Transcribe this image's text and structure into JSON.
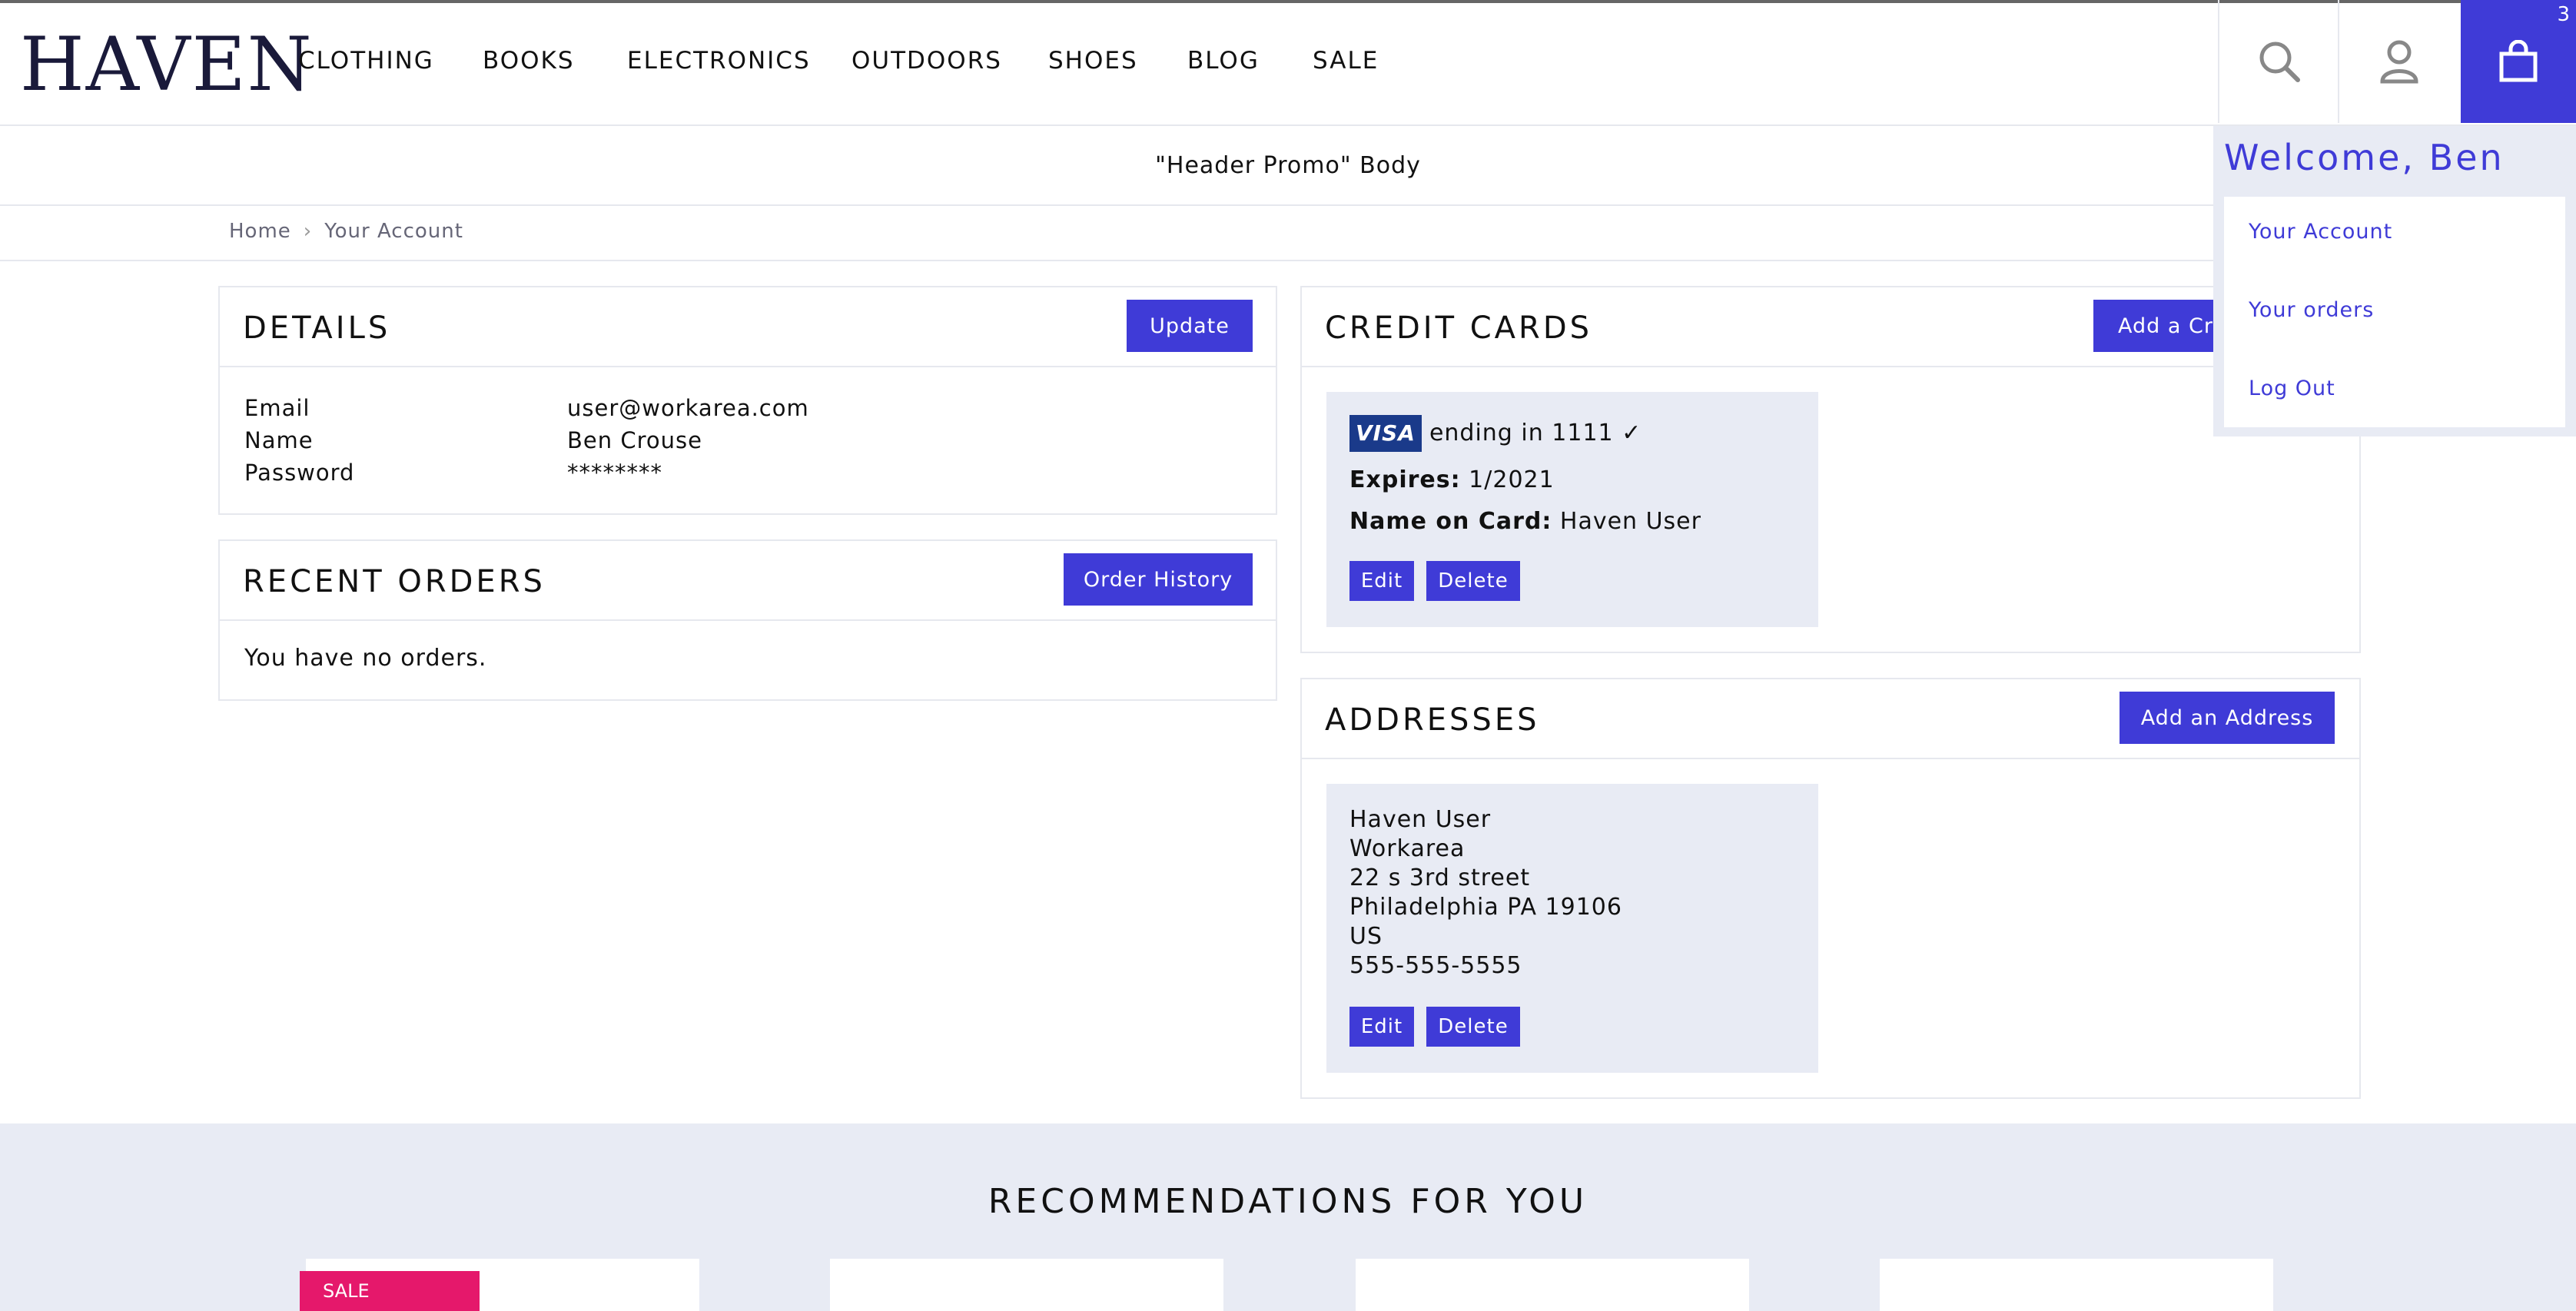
{
  "brand": {
    "logo_text": "HAVEN"
  },
  "nav": {
    "items": [
      "CLOTHING",
      "BOOKS",
      "ELECTRONICS",
      "OUTDOORS",
      "SHOES",
      "BLOG",
      "SALE"
    ]
  },
  "header": {
    "cart_count": "3"
  },
  "promo": {
    "text": "\"Header Promo\" Body"
  },
  "breadcrumb": {
    "home": "Home",
    "current": "Your Account"
  },
  "details": {
    "title": "DETAILS",
    "update_label": "Update",
    "rows": [
      {
        "label": "Email",
        "value": "user@workarea.com"
      },
      {
        "label": "Name",
        "value": "Ben Crouse"
      },
      {
        "label": "Password",
        "value": "********"
      }
    ]
  },
  "recent_orders": {
    "title": "RECENT ORDERS",
    "button_label": "Order History",
    "empty_text": "You have no orders."
  },
  "credit_cards": {
    "title": "CREDIT CARDS",
    "add_label": "Add a Cr",
    "card": {
      "brand": "VISA",
      "ending_text": "ending in 1111 ✓",
      "expires_label": "Expires:",
      "expires_value": "1/2021",
      "name_label": "Name on Card:",
      "name_value": "Haven User",
      "edit_label": "Edit",
      "delete_label": "Delete"
    }
  },
  "addresses": {
    "title": "ADDRESSES",
    "add_label": "Add an Address",
    "address": {
      "lines": [
        "Haven User",
        "Workarea",
        "22 s 3rd street",
        "Philadelphia PA 19106",
        "US",
        "555-555-5555"
      ],
      "edit_label": "Edit",
      "delete_label": "Delete"
    }
  },
  "account_menu": {
    "welcome": "Welcome, Ben",
    "items": [
      "Your Account",
      "Your orders",
      "Log Out"
    ]
  },
  "recommendations": {
    "title": "RECOMMENDATIONS FOR YOU",
    "sale_tag": "SALE"
  },
  "colors": {
    "accent": "#3f3bd7",
    "panel_grey": "#e8ebf4",
    "sale": "#e5186b",
    "border": "#e6e8ee"
  }
}
